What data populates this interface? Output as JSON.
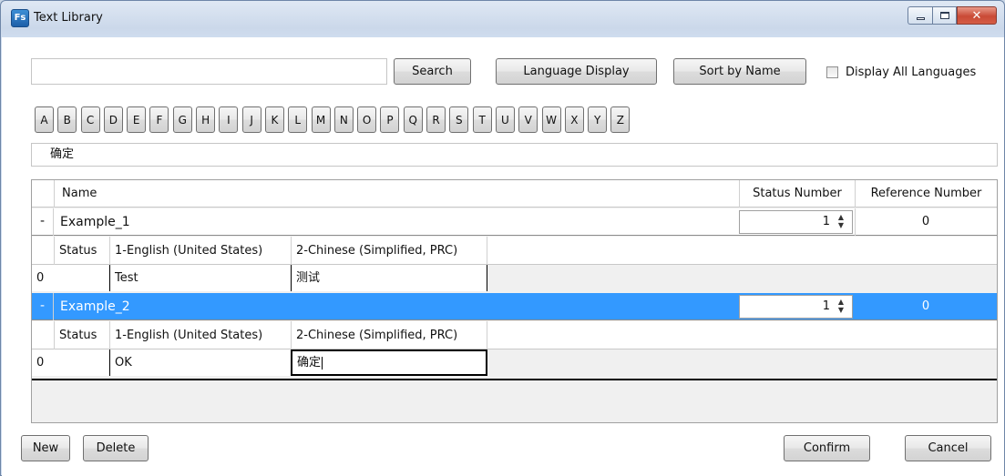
{
  "window": {
    "title": "Text Library",
    "app_icon": "Fs",
    "buttons": {
      "minimize": "minimize-icon",
      "maximize": "maximize-icon",
      "close": "close-icon"
    }
  },
  "toolbar": {
    "search_value": "",
    "search_button": "Search",
    "language_display_button": "Language Display",
    "sort_button": "Sort by Name",
    "display_all_label": "Display All Languages",
    "display_all_checked": false
  },
  "letters": [
    "A",
    "B",
    "C",
    "D",
    "E",
    "F",
    "G",
    "H",
    "I",
    "J",
    "K",
    "L",
    "M",
    "N",
    "O",
    "P",
    "Q",
    "R",
    "S",
    "T",
    "U",
    "V",
    "W",
    "X",
    "Y",
    "Z"
  ],
  "filter_text": "确定",
  "grid": {
    "columns": {
      "name": "Name",
      "status_number": "Status Number",
      "reference_number": "Reference Number"
    },
    "sub_columns": {
      "status": "Status",
      "lang1": "1-English (United States)",
      "lang2": "2-Chinese (Simplified, PRC)"
    },
    "rows": [
      {
        "toggle": "-",
        "name": "Example_1",
        "status_number": "1",
        "reference_number": "0",
        "selected": false,
        "entries": [
          {
            "status": "0",
            "lang1": "Test",
            "lang2": "测试"
          }
        ]
      },
      {
        "toggle": "-",
        "name": "Example_2",
        "status_number": "1",
        "reference_number": "0",
        "selected": true,
        "entries": [
          {
            "status": "0",
            "lang1": "OK",
            "lang2": "确定"
          }
        ]
      }
    ]
  },
  "footer": {
    "new_button": "New",
    "delete_button": "Delete",
    "confirm_button": "Confirm",
    "cancel_button": "Cancel"
  },
  "colors": {
    "selection": "#3399ff",
    "title_bar": "#cfdcee",
    "close_button": "#c94a36"
  }
}
